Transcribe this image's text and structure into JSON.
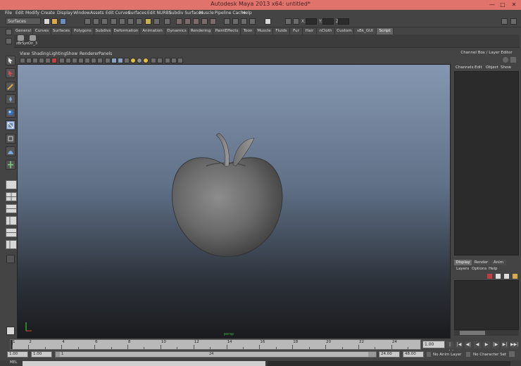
{
  "window": {
    "title": "Autodesk Maya 2013 x64: untitled*",
    "controls": [
      "—",
      "□",
      "✕"
    ]
  },
  "menus": [
    "File",
    "Edit",
    "Modify",
    "Create",
    "Display",
    "Window",
    "Assets",
    "Edit Curves",
    "Surfaces",
    "Edit NURBS",
    "Subdiv Surfaces",
    "Muscle",
    "Pipeline Cache",
    "Help"
  ],
  "status_line": {
    "mode": "Surfaces",
    "transform_labels": [
      "X:",
      "Y:",
      "Z:"
    ]
  },
  "shelf": {
    "tabs": [
      "General",
      "Curves",
      "Surfaces",
      "Polygons",
      "Subdivs",
      "Deformation",
      "Animation",
      "Dynamics",
      "Rendering",
      "PaintEffects",
      "Toon",
      "Muscle",
      "Fluids",
      "Fur",
      "Hair",
      "nCloth",
      "Custom",
      "sBk_GUI",
      "Script"
    ],
    "active_tab": "Script",
    "items": [
      "zBrSyn",
      "Ori_3"
    ]
  },
  "viewport": {
    "menus": [
      "View",
      "Shading",
      "Lighting",
      "Show",
      "Renderer",
      "Panels"
    ],
    "camera_label": "persp",
    "object": "apple"
  },
  "channel_box": {
    "title": "Channel Box / Layer Editor",
    "tabs": [
      "Channels",
      "Edit",
      "Object",
      "Show"
    ]
  },
  "layer_editor": {
    "tabs": [
      "Display",
      "Render",
      "Anim"
    ],
    "active_tab": "Display",
    "menus": [
      "Layers",
      "Options",
      "Help"
    ]
  },
  "time_slider": {
    "ticks": [
      "1",
      "2",
      "4",
      "6",
      "8",
      "10",
      "12",
      "14",
      "16",
      "18",
      "20",
      "22",
      "24"
    ],
    "current_frame": "1.00",
    "playback_buttons": [
      "|◀◀",
      "|◀",
      "◀|",
      "◀",
      "▶",
      "|▶",
      "▶|",
      "▶▶|"
    ]
  },
  "range_slider": {
    "start_time": "1.00",
    "playback_start": "1.00",
    "range_start": "1",
    "range_end": "24",
    "playback_end": "24.00",
    "end_time": "48.00",
    "anim_layer": "No Anim Layer",
    "character_set": "No Character Set"
  },
  "command_line": {
    "label": "MEL"
  },
  "colors": {
    "title_bar": "#e0746c",
    "ui_background": "#444444",
    "viewport_top": "#8597b0",
    "viewport_bottom": "#1a1b1e",
    "active_tool": "#6b89b8"
  }
}
